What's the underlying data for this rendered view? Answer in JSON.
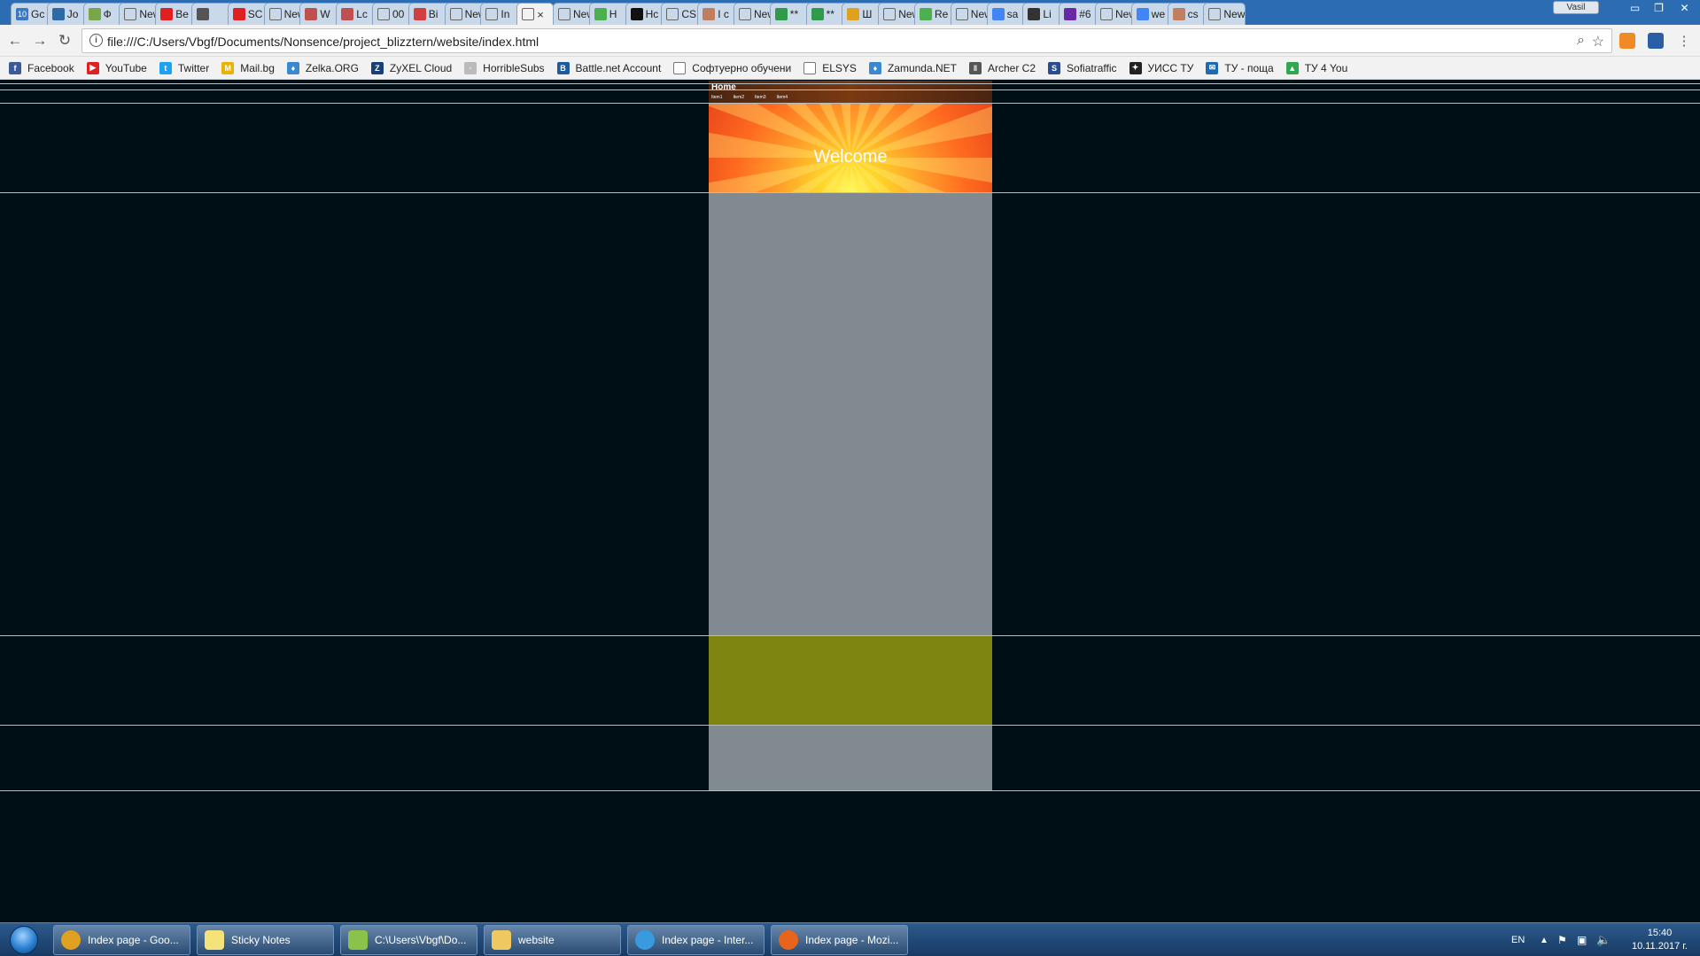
{
  "browser": {
    "tabs": [
      {
        "label": "Gc",
        "icon": "number-badge-icon",
        "badge": "10",
        "color": "#3a78c8"
      },
      {
        "label": "Jo",
        "icon": "book-icon",
        "color": "#2f6aa8"
      },
      {
        "label": "Ф",
        "icon": "gear-flower-icon",
        "color": "#7aa64a"
      },
      {
        "label": "New T",
        "icon": "blank-page-icon",
        "color": ""
      },
      {
        "label": "Be",
        "icon": "youtube-icon",
        "color": "#e02020"
      },
      {
        "label": "",
        "icon": "speaker-icon",
        "color": "#555"
      },
      {
        "label": "SC",
        "icon": "youtube-icon",
        "color": "#e02020"
      },
      {
        "label": "New T",
        "icon": "blank-page-icon",
        "color": ""
      },
      {
        "label": "W",
        "icon": "spiral-icon",
        "color": "#c05050"
      },
      {
        "label": "Lc",
        "icon": "spiral-icon",
        "color": "#c05050"
      },
      {
        "label": "00",
        "icon": "document-icon",
        "color": ""
      },
      {
        "label": "Bi",
        "icon": "circle-b-icon",
        "color": "#d04040"
      },
      {
        "label": "New T",
        "icon": "blank-page-icon",
        "color": ""
      },
      {
        "label": "In",
        "icon": "document-icon",
        "color": ""
      },
      {
        "label": "",
        "icon": "document-icon",
        "color": "",
        "active": true
      },
      {
        "label": "New T",
        "icon": "blank-page-icon",
        "color": ""
      },
      {
        "label": "H",
        "icon": "w3-icon",
        "color": "#4caf50"
      },
      {
        "label": "Hc",
        "icon": "m-icon",
        "color": "#111"
      },
      {
        "label": "CS",
        "icon": "document-icon",
        "color": ""
      },
      {
        "label": "I c",
        "icon": "feather-icon",
        "color": "#c08060"
      },
      {
        "label": "New T",
        "icon": "blank-page-icon",
        "color": ""
      },
      {
        "label": "**",
        "icon": "p-icon",
        "color": "#2e9a4a"
      },
      {
        "label": "**",
        "icon": "p-icon",
        "color": "#2e9a4a"
      },
      {
        "label": "Ш",
        "icon": "book-icon",
        "color": "#e0a020"
      },
      {
        "label": "New T",
        "icon": "blank-page-icon",
        "color": ""
      },
      {
        "label": "Re",
        "icon": "w3-icon",
        "color": "#4caf50"
      },
      {
        "label": "New T",
        "icon": "blank-page-icon",
        "color": ""
      },
      {
        "label": "sa",
        "icon": "google-icon",
        "color": "#4285f4"
      },
      {
        "label": "Li",
        "icon": "p-icon",
        "color": "#333"
      },
      {
        "label": "#6",
        "icon": "square-icon",
        "color": "#6a2aa8"
      },
      {
        "label": "New T",
        "icon": "blank-page-icon",
        "color": ""
      },
      {
        "label": "we",
        "icon": "google-icon",
        "color": "#4285f4"
      },
      {
        "label": "cs",
        "icon": "feather-icon",
        "color": "#c08060"
      },
      {
        "label": "New T",
        "icon": "blank-page-icon",
        "color": ""
      }
    ],
    "user_label": "Vasil",
    "url": "file:///C:/Users/Vbgf/Documents/Nonsence/project_blizztern/website/index.html",
    "bookmarks": [
      {
        "label": "Facebook",
        "icon": "facebook-icon",
        "color": "#3b5998",
        "glyph": "f"
      },
      {
        "label": "YouTube",
        "icon": "youtube-icon",
        "color": "#e02020",
        "glyph": "▶"
      },
      {
        "label": "Twitter",
        "icon": "twitter-icon",
        "color": "#1da1f2",
        "glyph": "t"
      },
      {
        "label": "Mail.bg",
        "icon": "mail-icon",
        "color": "#e8b400",
        "glyph": "M"
      },
      {
        "label": "Zelka.ORG",
        "icon": "drop-icon",
        "color": "#3a88d0",
        "glyph": "♦"
      },
      {
        "label": "ZyXEL Cloud",
        "icon": "zyxel-icon",
        "color": "#1a3e78",
        "glyph": "Z"
      },
      {
        "label": "HorribleSubs",
        "icon": "dots-icon",
        "color": "#bbb",
        "glyph": "·"
      },
      {
        "label": "Battle.net Account",
        "icon": "battlenet-icon",
        "color": "#1e5a9c",
        "glyph": "B"
      },
      {
        "label": "Софтуерно обучени",
        "icon": "document-icon",
        "color": "#ffffff",
        "glyph": ""
      },
      {
        "label": "ELSYS",
        "icon": "document-icon",
        "color": "#ffffff",
        "glyph": ""
      },
      {
        "label": "Zamunda.NET",
        "icon": "drop-icon",
        "color": "#3a88d0",
        "glyph": "♦"
      },
      {
        "label": "Archer C2",
        "icon": "router-icon",
        "color": "#555",
        "glyph": "‖"
      },
      {
        "label": "Sofiatraffic",
        "icon": "sofiatraffic-icon",
        "color": "#2a4d8f",
        "glyph": "S"
      },
      {
        "label": "УИСС ТУ",
        "icon": "shield-icon",
        "color": "#222",
        "glyph": "✦"
      },
      {
        "label": "ТУ - поща",
        "icon": "mail-icon",
        "color": "#1e6ab0",
        "glyph": "✉"
      },
      {
        "label": "ТУ 4 You",
        "icon": "drive-icon",
        "color": "#2fa84f",
        "glyph": "▲"
      }
    ]
  },
  "page": {
    "nav_home": "Home",
    "nav_items": [
      "Item1",
      "Item2",
      "Item3",
      "Item4"
    ],
    "welcome": "Welcome",
    "colors": {
      "background": "#000e15",
      "main": "#818991",
      "olive": "#7f8511",
      "banner_center": "#fffa5a",
      "banner_edge": "#e8471b"
    }
  },
  "taskbar": {
    "items": [
      {
        "label": "Index page - Goo...",
        "icon": "chrome-icon",
        "color": "#e0a020"
      },
      {
        "label": "Sticky Notes",
        "icon": "sticky-notes-icon",
        "color": "#f5e27a"
      },
      {
        "label": "C:\\Users\\Vbgf\\Do...",
        "icon": "notepad-plus-icon",
        "color": "#8bc34a"
      },
      {
        "label": "website",
        "icon": "folder-icon",
        "color": "#f0c860"
      },
      {
        "label": "Index page - Inter...",
        "icon": "internet-explorer-icon",
        "color": "#3a9ae0"
      },
      {
        "label": "Index page - Mozi...",
        "icon": "firefox-icon",
        "color": "#e8641b"
      }
    ],
    "language": "EN",
    "time": "15:40",
    "date": "10.11.2017 г."
  }
}
